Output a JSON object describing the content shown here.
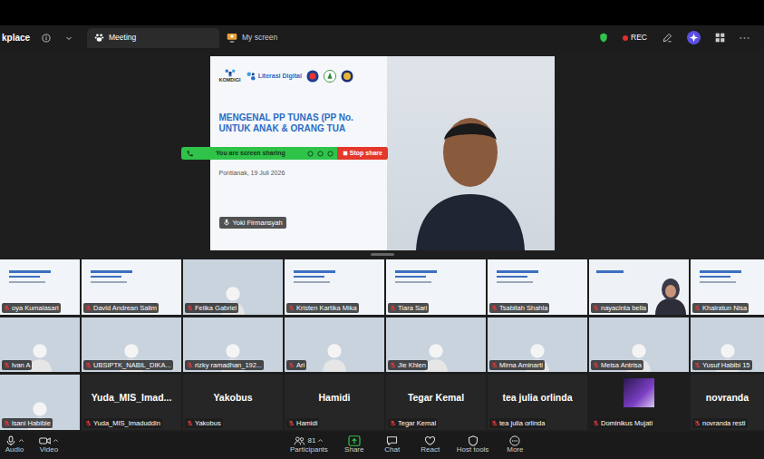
{
  "top_bar": {
    "workspace": "kplace",
    "tabs": [
      {
        "label": "Meeting",
        "selected": true
      },
      {
        "label": "My screen",
        "selected": false
      }
    ],
    "recording": {
      "label": "REC",
      "on": true
    }
  },
  "share_bar": {
    "status": "You are screen sharing",
    "stop": "Stop share"
  },
  "shared_slide": {
    "logos": [
      "KOMDIGI",
      "Literasi Digital"
    ],
    "title": [
      "MENGENAL PP TUNAS (PP No.",
      "UNTUK ANAK & ORANG TUA"
    ],
    "place_date": "Pontianak, 19 Juli 2026"
  },
  "speaker": {
    "name": "Yoki Firmansyah",
    "muted": false
  },
  "gallery": {
    "rows": [
      [
        {
          "name": "oya Kumalasari",
          "kind": "slide",
          "muted": true
        },
        {
          "name": "David Andrean Salim",
          "kind": "slide",
          "muted": true
        },
        {
          "name": "Felika Gabriel",
          "kind": "avatar",
          "muted": true
        },
        {
          "name": "Kristen Kartika Mika",
          "kind": "slide",
          "muted": true
        },
        {
          "name": "Tiara Sari",
          "kind": "slide",
          "muted": true
        },
        {
          "name": "Tsabitah Shahla",
          "kind": "slide",
          "muted": true
        },
        {
          "name": "nayacinta bella",
          "kind": "camera",
          "muted": true
        },
        {
          "name": "Khairatun Nisa",
          "kind": "slide",
          "muted": true
        }
      ],
      [
        {
          "name": "lvan A",
          "kind": "avatar",
          "muted": true
        },
        {
          "name": "UBSIPTK_NABIL_DIKA...",
          "kind": "avatar",
          "muted": true
        },
        {
          "name": "rizky ramadhan_192...",
          "kind": "avatar",
          "muted": true
        },
        {
          "name": "Ari",
          "kind": "avatar",
          "muted": true
        },
        {
          "name": "Jie Khlen",
          "kind": "avatar",
          "muted": true
        },
        {
          "name": "Mirna Aminarti",
          "kind": "avatar",
          "muted": true
        },
        {
          "name": "Meisa Antrisa",
          "kind": "avatar",
          "muted": true
        },
        {
          "name": "Yusuf Habibi 15",
          "kind": "avatar",
          "muted": true
        }
      ],
      [
        {
          "name": "lsani Habibie",
          "kind": "avatar",
          "muted": true
        },
        {
          "name": "Yuda_MIS_Imaduddin",
          "kind": "name",
          "display": "Yuda_MIS_Imad...",
          "muted": true
        },
        {
          "name": "Yakobus",
          "kind": "name",
          "display": "Yakobus",
          "muted": true
        },
        {
          "name": "Hamidi",
          "kind": "name",
          "display": "Hamidi",
          "muted": true
        },
        {
          "name": "Tegar Kemal",
          "kind": "name",
          "display": "Tegar Kemal",
          "muted": true
        },
        {
          "name": "tea julia orlinda",
          "kind": "name",
          "display": "tea julia orlinda",
          "muted": true
        },
        {
          "name": "Dominikus Mujati",
          "kind": "image",
          "muted": true
        },
        {
          "name": "novranda resti",
          "kind": "name",
          "display": "novranda",
          "muted": true
        }
      ]
    ]
  },
  "toolbar": [
    {
      "label": "Audio",
      "kind": "menu"
    },
    {
      "label": "Video",
      "kind": "menu"
    },
    {
      "label": "Participants",
      "kind": "menu",
      "count": "81"
    },
    {
      "label": "Share",
      "kind": "share"
    },
    {
      "label": "Chat",
      "kind": "button"
    },
    {
      "label": "React",
      "kind": "button"
    },
    {
      "label": "Host tools",
      "kind": "button"
    },
    {
      "label": "More",
      "kind": "button"
    }
  ]
}
